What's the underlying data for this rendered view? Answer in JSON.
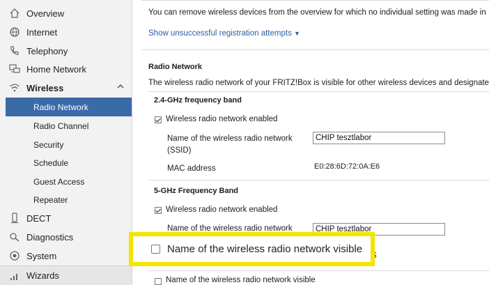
{
  "sidebar": {
    "items": [
      {
        "label": "Overview",
        "icon": "home-icon"
      },
      {
        "label": "Internet",
        "icon": "globe-icon"
      },
      {
        "label": "Telephony",
        "icon": "phone-icon"
      },
      {
        "label": "Home Network",
        "icon": "network-icon"
      },
      {
        "label": "Wireless",
        "icon": "wifi-icon"
      }
    ],
    "wireless_sub": [
      {
        "label": "Radio Network"
      },
      {
        "label": "Radio Channel"
      },
      {
        "label": "Security"
      },
      {
        "label": "Schedule"
      },
      {
        "label": "Guest Access"
      },
      {
        "label": "Repeater"
      }
    ],
    "items_after": [
      {
        "label": "DECT",
        "icon": "dect-icon"
      },
      {
        "label": "Diagnostics",
        "icon": "diagnostics-icon"
      },
      {
        "label": "System",
        "icon": "system-icon"
      },
      {
        "label": "Wizards",
        "icon": "wizards-icon"
      }
    ]
  },
  "main": {
    "intro_text": "You can remove wireless devices from the overview for which no individual setting was made in",
    "show_attempts_link": "Show unsuccessful registration attempts",
    "section_title": "Radio Network",
    "section_desc": "The wireless radio network of your FRITZ!Box is visible for other wireless devices and designate",
    "band1": {
      "title": "2.4-GHz frequency band",
      "enabled_label": "Wireless radio network enabled",
      "ssid_label_line1": "Name of the wireless radio network",
      "ssid_label_line2": "(SSID)",
      "ssid_value": "CHIP tesztlabor",
      "mac_label": "MAC address",
      "mac_value": "E0:28:6D:72:0A:E6"
    },
    "band2": {
      "title": "5-GHz Frequency Band",
      "enabled_label": "Wireless radio network enabled",
      "ssid_label": "Name of the wireless radio network",
      "ssid_value": "CHIP tesztlabor",
      "partial_text": "S"
    },
    "visible_label": "Name of the wireless radio network visible"
  },
  "highlight": {
    "label": "Name of the wireless radio network visible",
    "border_color": "#f4e400"
  },
  "colors": {
    "active_nav": "#3a6aa8",
    "link": "#2a5ea8"
  }
}
